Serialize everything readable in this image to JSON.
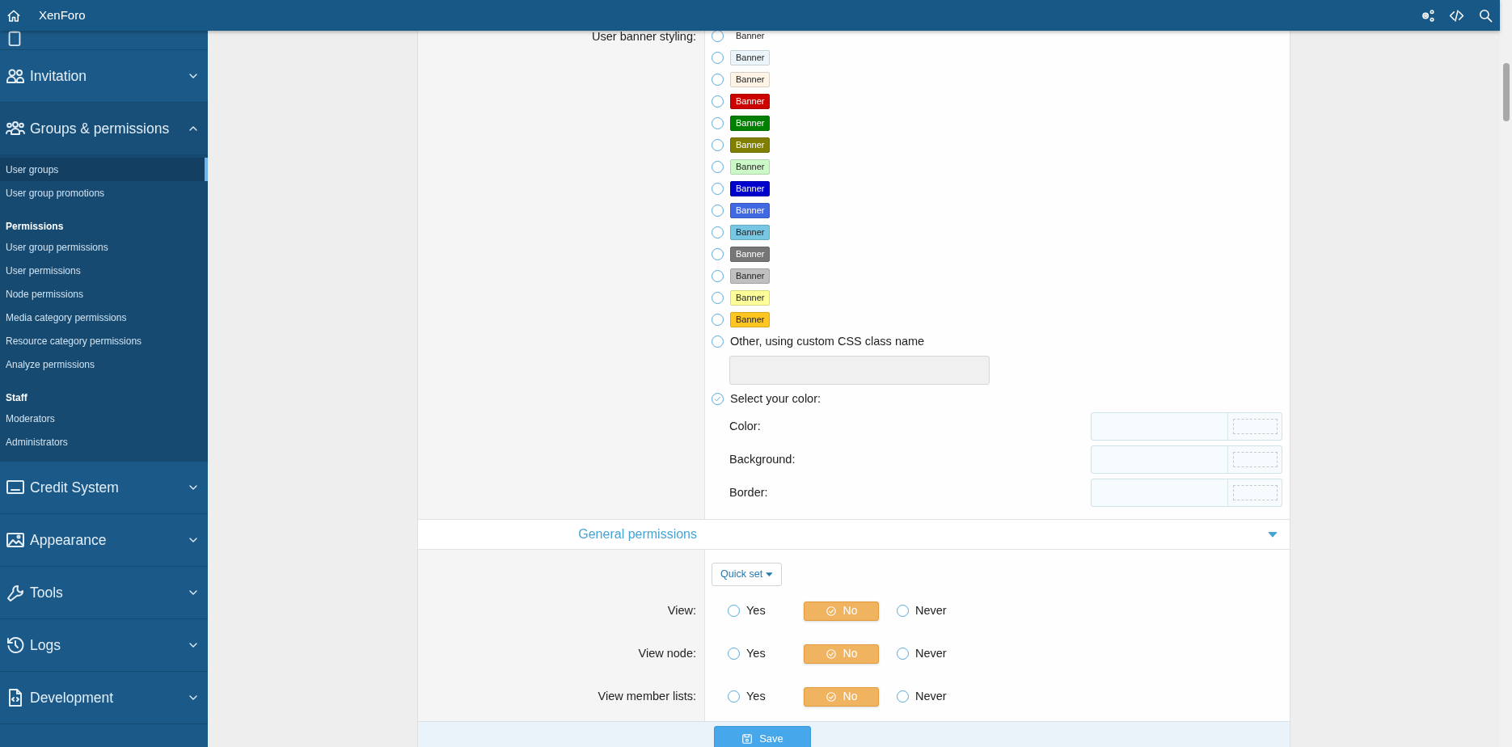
{
  "topbar": {
    "title": "XenForo"
  },
  "sidebar": {
    "sections": [
      {
        "label": "Invitation",
        "expanded": false
      },
      {
        "label": "Groups & permissions",
        "expanded": true,
        "groups": [
          {
            "items": [
              {
                "label": "User groups",
                "selected": true
              },
              {
                "label": "User group promotions",
                "selected": false
              }
            ]
          },
          {
            "heading": "Permissions",
            "items": [
              {
                "label": "User group permissions",
                "selected": false
              },
              {
                "label": "User permissions",
                "selected": false
              },
              {
                "label": "Node permissions",
                "selected": false
              },
              {
                "label": "Media category permissions",
                "selected": false
              },
              {
                "label": "Resource category permissions",
                "selected": false
              },
              {
                "label": "Analyze permissions",
                "selected": false
              }
            ]
          },
          {
            "heading": "Staff",
            "items": [
              {
                "label": "Moderators",
                "selected": false
              },
              {
                "label": "Administrators",
                "selected": false
              }
            ]
          }
        ]
      },
      {
        "label": "Credit System",
        "expanded": false
      },
      {
        "label": "Appearance",
        "expanded": false
      },
      {
        "label": "Tools",
        "expanded": false
      },
      {
        "label": "Logs",
        "expanded": false
      },
      {
        "label": "Development",
        "expanded": false
      }
    ]
  },
  "banner_styling": {
    "label": "User banner styling:",
    "options": [
      {
        "text": "Banner",
        "selected": false,
        "kind": "plain"
      },
      {
        "text": "Banner",
        "selected": false,
        "kind": "filled",
        "color": "#eaf6fc"
      },
      {
        "text": "Banner",
        "selected": false,
        "kind": "filled",
        "color": "#fff4e5"
      },
      {
        "text": "Banner",
        "selected": false,
        "kind": "filled",
        "color": "#cc0000"
      },
      {
        "text": "Banner",
        "selected": false,
        "kind": "filled",
        "color": "#008000"
      },
      {
        "text": "Banner",
        "selected": false,
        "kind": "filled",
        "color": "#817f00"
      },
      {
        "text": "Banner",
        "selected": false,
        "kind": "filled",
        "color": "#ccf9c8"
      },
      {
        "text": "Banner",
        "selected": false,
        "kind": "filled",
        "color": "#0000cc"
      },
      {
        "text": "Banner",
        "selected": false,
        "kind": "filled",
        "color": "#4169e1"
      },
      {
        "text": "Banner",
        "selected": false,
        "kind": "filled",
        "color": "#77c7e4"
      },
      {
        "text": "Banner",
        "selected": false,
        "kind": "filled",
        "color": "#767676"
      },
      {
        "text": "Banner",
        "selected": false,
        "kind": "filled",
        "color": "#c0c0c0"
      },
      {
        "text": "Banner",
        "selected": false,
        "kind": "filled",
        "color": "#ffff99"
      },
      {
        "text": "Banner",
        "selected": false,
        "kind": "filled",
        "color": "#ffc520"
      }
    ],
    "other": {
      "label": "Other, using custom CSS class name",
      "selected": false
    },
    "custom": {
      "label": "Select your color:",
      "selected": true,
      "fields": [
        {
          "label": "Color:"
        },
        {
          "label": "Background:"
        },
        {
          "label": "Border:"
        }
      ]
    }
  },
  "general_permissions": {
    "title": "General permissions",
    "quick_set": "Quick set",
    "rows": [
      {
        "label": "View:",
        "options": [
          {
            "text": "Yes",
            "selected": false
          },
          {
            "text": "No",
            "selected": true
          },
          {
            "text": "Never",
            "selected": false
          }
        ]
      },
      {
        "label": "View node:",
        "options": [
          {
            "text": "Yes",
            "selected": false
          },
          {
            "text": "No",
            "selected": true
          },
          {
            "text": "Never",
            "selected": false
          }
        ]
      },
      {
        "label": "View member lists:",
        "options": [
          {
            "text": "Yes",
            "selected": false
          },
          {
            "text": "No",
            "selected": true
          },
          {
            "text": "Never",
            "selected": false
          }
        ]
      }
    ]
  },
  "save": "Save"
}
